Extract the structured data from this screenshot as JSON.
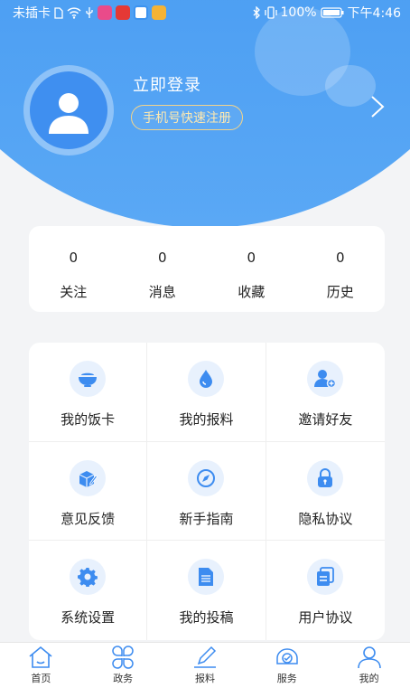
{
  "status_bar": {
    "carrier": "未插卡",
    "battery": "100%",
    "time": "下午4:46"
  },
  "profile": {
    "login_label": "立即登录",
    "register_label": "手机号快速注册"
  },
  "stats": [
    {
      "value": "0",
      "label": "关注"
    },
    {
      "value": "0",
      "label": "消息"
    },
    {
      "value": "0",
      "label": "收藏"
    },
    {
      "value": "0",
      "label": "历史"
    }
  ],
  "menu": [
    {
      "label": "我的饭卡",
      "icon": "bowl-icon"
    },
    {
      "label": "我的报料",
      "icon": "drop-icon"
    },
    {
      "label": "邀请好友",
      "icon": "add-user-icon"
    },
    {
      "label": "意见反馈",
      "icon": "feedback-box-icon"
    },
    {
      "label": "新手指南",
      "icon": "compass-icon"
    },
    {
      "label": "隐私协议",
      "icon": "lock-icon"
    },
    {
      "label": "系统设置",
      "icon": "gear-icon"
    },
    {
      "label": "我的投稿",
      "icon": "document-icon"
    },
    {
      "label": "用户协议",
      "icon": "agreement-icon"
    }
  ],
  "nav": [
    {
      "label": "首页",
      "icon": "home-icon"
    },
    {
      "label": "政务",
      "icon": "clover-icon"
    },
    {
      "label": "报料",
      "icon": "pen-icon"
    },
    {
      "label": "服务",
      "icon": "service-icon"
    },
    {
      "label": "我的",
      "icon": "profile-icon"
    }
  ],
  "colors": {
    "primary": "#3c93f0",
    "register_border": "#f3d48a",
    "icon_blue": "#3d8cf0",
    "icon_bg": "#e8f1fd"
  }
}
